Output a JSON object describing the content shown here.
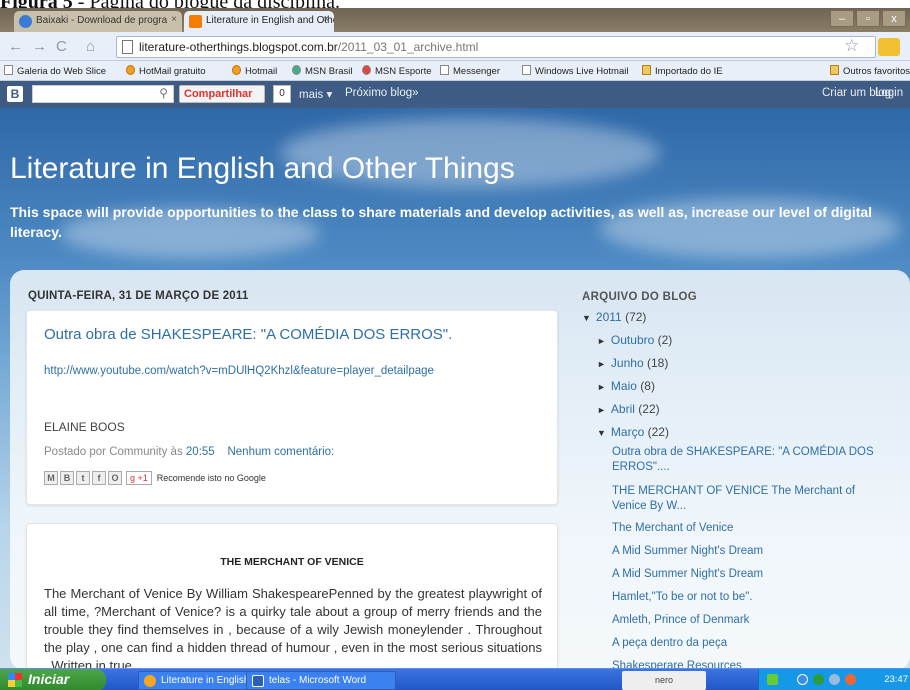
{
  "caption": {
    "label": "Figura 5",
    "text": " - Página do blogue da disciplina."
  },
  "tabs": [
    {
      "label": "Baixaki - Download de progra"
    },
    {
      "label": "Literature in English and Othe"
    }
  ],
  "window_buttons": {
    "minimize": "–",
    "maximize": "▫",
    "close": "x"
  },
  "address": {
    "host": "literature-otherthings.blogspot.com.br",
    "path": "/2011_03_01_archive.html"
  },
  "bookmarks": [
    "Galeria do Web Slice",
    "HotMail gratuito",
    "Hotmail",
    "MSN Brasil",
    "MSN Esporte",
    "Messenger",
    "Windows Live Hotmail",
    "Importado do IE",
    "Outros favoritos"
  ],
  "bloggerbar": {
    "share": "Compartilhar",
    "count": "0",
    "more": "mais ▾",
    "next": "Próximo blog»",
    "create": "Criar um blog",
    "login": "Login"
  },
  "blog": {
    "title": "Literature in English and Other Things",
    "description": "This space will provide opportunities to the class to share materials and develop activities, as well as, increase our level of digital literacy."
  },
  "post1": {
    "date": "QUINTA-FEIRA, 31 DE MARÇO DE 2011",
    "title": "Outra obra de SHAKESPEARE: \"A COMÉDIA DOS ERROS\".",
    "link": "http://www.youtube.com/watch?v=mDUlHQ2Khzl&feature=player_detailpage",
    "author": "ELAINE BOOS",
    "posted_prefix": "Postado por Community às ",
    "time": "20:55",
    "comments": "Nenhum comentário:",
    "gplus": "+1",
    "recommend": "Recomende isto no Google"
  },
  "post2": {
    "title": "THE MERCHANT OF VENICE",
    "body": "The Merchant of Venice By William ShakespearePenned by the greatest playwright of all time, ?Merchant of Venice? is a quirky tale about a group of merry friends and the trouble they find themselves in , because of a wily Jewish moneylender . Throughout the play , one can find a hidden thread of humour , even in the most serious situations . Written in true"
  },
  "archive": {
    "heading": "ARQUIVO DO BLOG",
    "year": "2011",
    "year_count": "(72)",
    "months": [
      {
        "name": "Outubro",
        "count": "(2)"
      },
      {
        "name": "Junho",
        "count": "(18)"
      },
      {
        "name": "Maio",
        "count": "(8)"
      },
      {
        "name": "Abril",
        "count": "(22)"
      },
      {
        "name": "Março",
        "count": "(22)"
      }
    ],
    "posts": [
      "Outra obra de SHAKESPEARE: \"A COMÉDIA DOS ERROS\"....",
      "THE MERCHANT OF VENICE The Merchant of Venice By W...",
      "The Merchant of Venice",
      "A Mid Summer Night's Dream",
      "A Mid Summer Night's Dream",
      "Hamlet,\"To be or not to be\".",
      "Amleth, Prince of Denmark",
      "A peça dentro da peça",
      "Shakesperare Resources"
    ]
  },
  "taskbar": {
    "start": "Iniciar",
    "tasks": [
      "Literature in English a...",
      "telas - Microsoft Word"
    ],
    "nero": "nero",
    "clock": "23:47"
  },
  "icons": {
    "back": "back-arrow-icon",
    "forward": "forward-arrow-icon",
    "reload": "reload-icon",
    "home": "home-icon",
    "star": "star-icon",
    "wrench": "wrench-icon",
    "search": "search-icon"
  }
}
